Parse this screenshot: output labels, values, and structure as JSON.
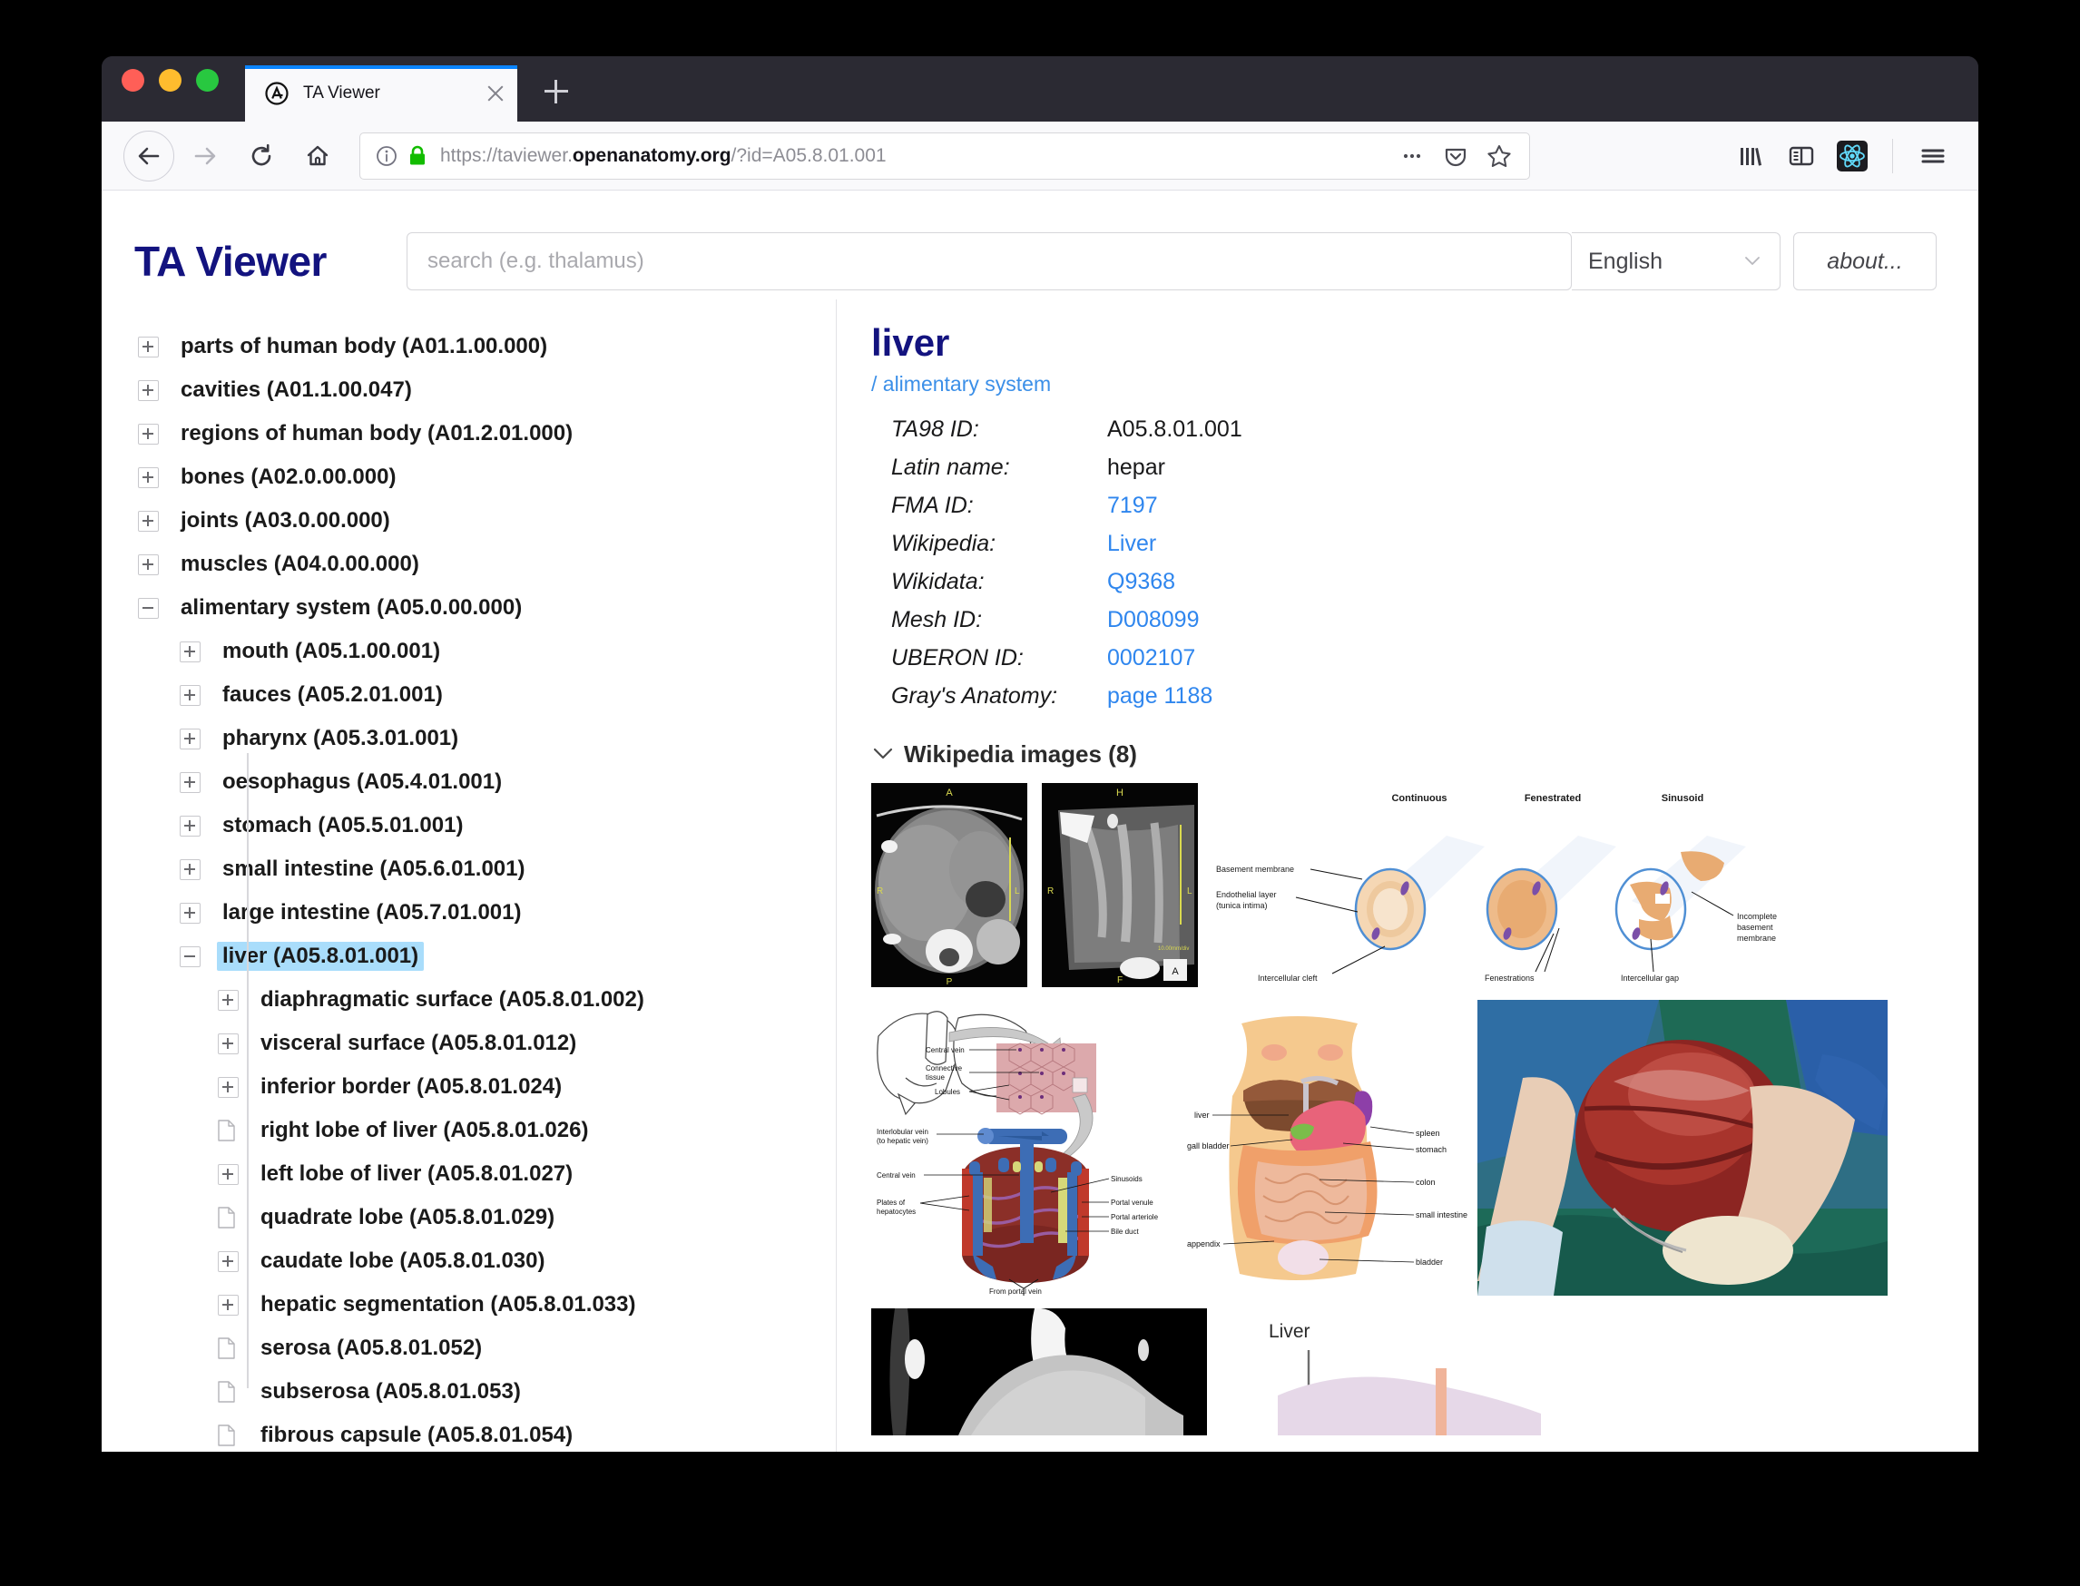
{
  "browser": {
    "tab": {
      "title": "TA Viewer",
      "favicon": "circled-a-icon"
    },
    "url": {
      "scheme": "https://",
      "subdomain": "taviewer.",
      "host": "openanatomy.org",
      "path": "/?id=A05.8.01.001"
    },
    "nav": {
      "back": "back-arrow-icon",
      "forward": "forward-arrow-icon",
      "reload": "reload-icon",
      "home": "home-icon"
    },
    "urlbar_actions": [
      "page-actions-icon",
      "pocket-icon",
      "bookmark-star-icon"
    ],
    "toolbar_right": [
      "library-icon",
      "sidebar-icon",
      "react-devtools-icon",
      "hamburger-menu-icon"
    ]
  },
  "app": {
    "title": "TA Viewer",
    "search": {
      "placeholder": "search (e.g. thalamus)",
      "value": ""
    },
    "language": {
      "selected": "English"
    },
    "about_label": "about..."
  },
  "tree": {
    "items": [
      {
        "label": "parts of human body (A01.1.00.000)",
        "level": 1,
        "icon": "expander-plus",
        "selected": false
      },
      {
        "label": "cavities (A01.1.00.047)",
        "level": 1,
        "icon": "expander-plus",
        "selected": false
      },
      {
        "label": "regions of human body (A01.2.01.000)",
        "level": 1,
        "icon": "expander-plus",
        "selected": false
      },
      {
        "label": "bones (A02.0.00.000)",
        "level": 1,
        "icon": "expander-plus",
        "selected": false
      },
      {
        "label": "joints (A03.0.00.000)",
        "level": 1,
        "icon": "expander-plus",
        "selected": false
      },
      {
        "label": "muscles (A04.0.00.000)",
        "level": 1,
        "icon": "expander-plus",
        "selected": false
      },
      {
        "label": "alimentary system (A05.0.00.000)",
        "level": 1,
        "icon": "expander-minus",
        "selected": false
      },
      {
        "label": "mouth (A05.1.00.001)",
        "level": 2,
        "icon": "expander-plus",
        "selected": false
      },
      {
        "label": "fauces (A05.2.01.001)",
        "level": 2,
        "icon": "expander-plus",
        "selected": false
      },
      {
        "label": "pharynx (A05.3.01.001)",
        "level": 2,
        "icon": "expander-plus",
        "selected": false
      },
      {
        "label": "oesophagus (A05.4.01.001)",
        "level": 2,
        "icon": "expander-plus",
        "selected": false
      },
      {
        "label": "stomach (A05.5.01.001)",
        "level": 2,
        "icon": "expander-plus",
        "selected": false
      },
      {
        "label": "small intestine (A05.6.01.001)",
        "level": 2,
        "icon": "expander-plus",
        "selected": false
      },
      {
        "label": "large intestine (A05.7.01.001)",
        "level": 2,
        "icon": "expander-plus",
        "selected": false
      },
      {
        "label": "liver (A05.8.01.001)",
        "level": 2,
        "icon": "expander-minus",
        "selected": true
      },
      {
        "label": "diaphragmatic surface (A05.8.01.002)",
        "level": 3,
        "icon": "expander-plus",
        "selected": false
      },
      {
        "label": "visceral surface (A05.8.01.012)",
        "level": 3,
        "icon": "expander-plus",
        "selected": false
      },
      {
        "label": "inferior border (A05.8.01.024)",
        "level": 3,
        "icon": "expander-plus",
        "selected": false
      },
      {
        "label": "right lobe of liver (A05.8.01.026)",
        "level": 3,
        "icon": "leaf",
        "selected": false
      },
      {
        "label": "left lobe of liver (A05.8.01.027)",
        "level": 3,
        "icon": "expander-plus",
        "selected": false
      },
      {
        "label": "quadrate lobe (A05.8.01.029)",
        "level": 3,
        "icon": "leaf",
        "selected": false
      },
      {
        "label": "caudate lobe (A05.8.01.030)",
        "level": 3,
        "icon": "expander-plus",
        "selected": false
      },
      {
        "label": "hepatic segmentation (A05.8.01.033)",
        "level": 3,
        "icon": "expander-plus",
        "selected": false
      },
      {
        "label": "serosa (A05.8.01.052)",
        "level": 3,
        "icon": "leaf",
        "selected": false
      },
      {
        "label": "subserosa (A05.8.01.053)",
        "level": 3,
        "icon": "leaf",
        "selected": false
      },
      {
        "label": "fibrous capsule (A05.8.01.054)",
        "level": 3,
        "icon": "leaf",
        "selected": false
      }
    ]
  },
  "detail": {
    "title": "liver",
    "breadcrumb": "/ alimentary system",
    "meta": [
      {
        "label": "TA98 ID:",
        "value": "A05.8.01.001",
        "link": false
      },
      {
        "label": "Latin name:",
        "value": "hepar",
        "link": false
      },
      {
        "label": "FMA ID:",
        "value": "7197",
        "link": true
      },
      {
        "label": "Wikipedia:",
        "value": "Liver",
        "link": true
      },
      {
        "label": "Wikidata:",
        "value": "Q9368",
        "link": true
      },
      {
        "label": "Mesh ID:",
        "value": "D008099",
        "link": true
      },
      {
        "label": "UBERON ID:",
        "value": "0002107",
        "link": true
      },
      {
        "label": "Gray's Anatomy:",
        "value": "page 1188",
        "link": true
      }
    ],
    "images_section": {
      "label": "Wikipedia images (8)",
      "count": 8,
      "collapse_icon": "chevron-down-icon"
    },
    "gallery": [
      {
        "name": "ct-axial-abdomen",
        "kind": "ct-scan",
        "markers": [
          "A",
          "R",
          "L",
          "P"
        ]
      },
      {
        "name": "ct-coronal-abdomen",
        "kind": "ct-scan",
        "markers": [
          "H",
          "R",
          "L",
          "F",
          "10.00mm/div"
        ]
      },
      {
        "name": "capillary-types-diagram",
        "kind": "diagram",
        "headings": [
          "Continuous",
          "Fenestrated",
          "Sinusoid"
        ],
        "labels": [
          "Basement membrane",
          "Endothelial layer (tunica intima)",
          "Intercellular cleft",
          "Fenestrations",
          "Incomplete basement membrane",
          "Intercellular gap"
        ]
      },
      {
        "name": "liver-lobule-diagram",
        "kind": "diagram",
        "labels": [
          "Central vein",
          "Connective tissue",
          "Lobules",
          "Interlobular vein (to hepatic vein)",
          "Central vein",
          "Plates of hepatocytes",
          "Sinusoids",
          "Portal venule",
          "Portal arteriole",
          "Bile duct",
          "From portal vein"
        ]
      },
      {
        "name": "abdominal-organs-diagram",
        "kind": "diagram",
        "labels": [
          "liver",
          "gall bladder",
          "appendix",
          "spleen",
          "stomach",
          "colon",
          "small intestine",
          "bladder"
        ]
      },
      {
        "name": "liver-surgery-photo",
        "kind": "photo",
        "labels": []
      },
      {
        "name": "liver-ultrasound",
        "kind": "ultrasound",
        "labels": []
      },
      {
        "name": "liver-position-diagram",
        "kind": "diagram",
        "labels": [
          "Liver"
        ]
      }
    ]
  },
  "colors": {
    "brand": "#13137f",
    "link": "#2f86ee",
    "selection": "#a9ddfb",
    "tab_accent": "#0a84ff"
  }
}
